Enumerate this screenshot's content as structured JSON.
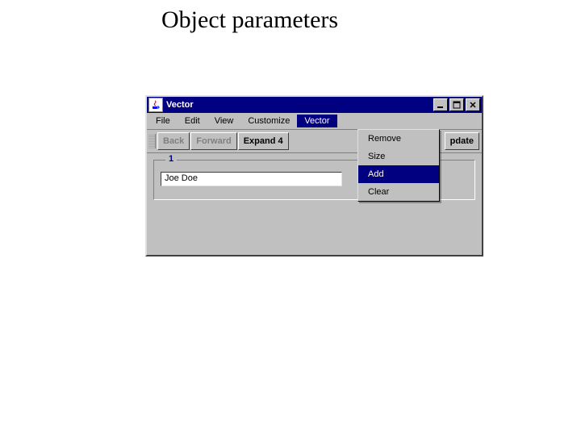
{
  "page": {
    "heading": "Object parameters"
  },
  "window": {
    "title": "Vector",
    "controls": {
      "minimize": "_",
      "maximize": "□",
      "close": "×"
    }
  },
  "menubar": {
    "items": [
      {
        "label": "File"
      },
      {
        "label": "Edit"
      },
      {
        "label": "View"
      },
      {
        "label": "Customize"
      },
      {
        "label": "Vector",
        "open": true
      }
    ]
  },
  "toolbar": {
    "back": "Back",
    "forward": "Forward",
    "expand": "Expand 4",
    "update": "pdate"
  },
  "group": {
    "legend": "1",
    "value": "Joe Doe"
  },
  "dropdown": {
    "items": [
      {
        "label": "Remove"
      },
      {
        "label": "Size"
      },
      {
        "label": "Add",
        "selected": true
      },
      {
        "label": "Clear"
      }
    ]
  }
}
